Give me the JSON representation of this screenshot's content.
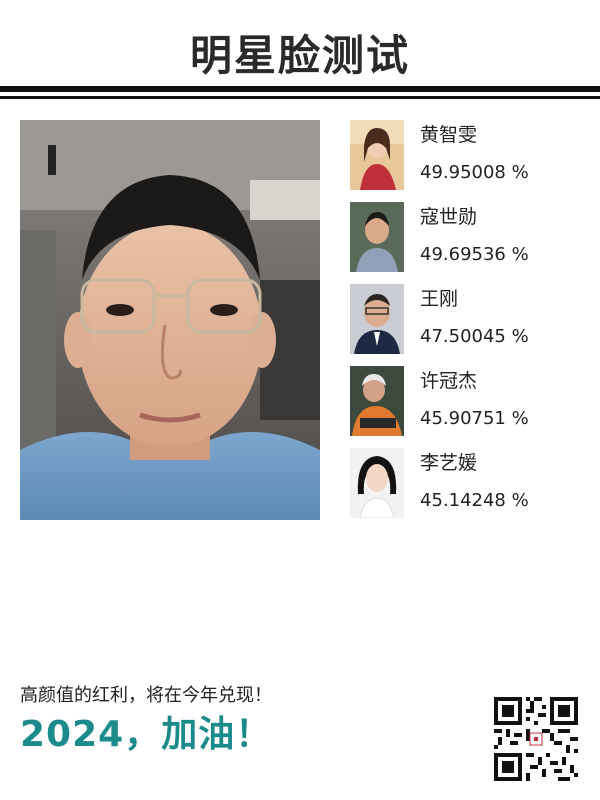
{
  "header": {
    "title": "明星脸测试"
  },
  "photo": {
    "label": "user-selfie"
  },
  "matches": [
    {
      "name": "黄智雯",
      "score": "49.95008 %",
      "icon": "celebrity-photo-1"
    },
    {
      "name": "寇世勋",
      "score": "49.69536 %",
      "icon": "celebrity-photo-2"
    },
    {
      "name": "王刚",
      "score": "47.50045 %",
      "icon": "celebrity-photo-3"
    },
    {
      "name": "许冠杰",
      "score": "45.90751 %",
      "icon": "celebrity-photo-4"
    },
    {
      "name": "李艺媛",
      "score": "45.14248 %",
      "icon": "celebrity-photo-5"
    }
  ],
  "footer": {
    "slogan": "高颜值的红利，将在今年兑现！",
    "slogan_big": "2024，加油！",
    "accent_color": "#1b8a8a",
    "qr_icon": "qr-code"
  }
}
